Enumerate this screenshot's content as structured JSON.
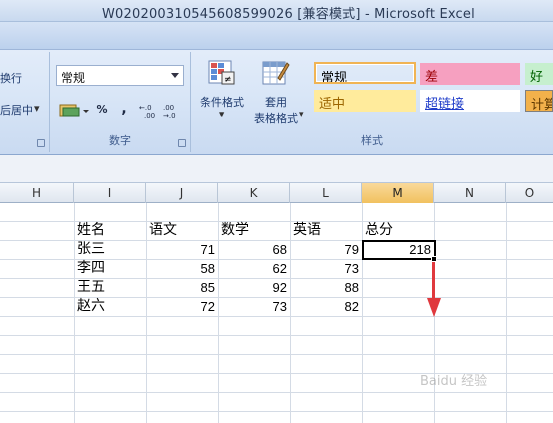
{
  "window": {
    "title": "W020200310545608599026  [兼容模式] - Microsoft Excel"
  },
  "ribbon": {
    "alignment": {
      "wrap_label": "换行",
      "merge_center_label": "后居中"
    },
    "number": {
      "format_value": "常规",
      "percent_label": "%",
      "comma_label": ",",
      "inc_decimal_label": "←.0 .00",
      "dec_decimal_label": ".00 →.0",
      "group_label": "数字"
    },
    "styles": {
      "conditional_format_label": "条件格式",
      "format_table_label_1": "套用",
      "format_table_label_2": "表格格式",
      "cells": [
        {
          "label": "常规",
          "bg": "#ffffff",
          "color": "#000000"
        },
        {
          "label": "差",
          "bg": "#f6a0c0",
          "color": "#9c0006"
        },
        {
          "label": "好",
          "bg": "#c6efce",
          "color": "#006100"
        },
        {
          "label": "适中",
          "bg": "#ffeb9c",
          "color": "#9c6500"
        },
        {
          "label": "超链接",
          "bg": "#ffffff",
          "color": "#1f3cc9"
        },
        {
          "label": "计算",
          "bg": "#f2b14b",
          "color": "#5e3800"
        }
      ],
      "group_label": "样式"
    }
  },
  "sheet": {
    "columns": [
      "H",
      "I",
      "J",
      "K",
      "L",
      "M",
      "N",
      "O"
    ],
    "active_column": "M",
    "headers": [
      "姓名",
      "语文",
      "数学",
      "英语",
      "总分"
    ],
    "rows": [
      {
        "name": "张三",
        "chinese": "71",
        "math": "68",
        "english": "79",
        "total": "218"
      },
      {
        "name": "李四",
        "chinese": "58",
        "math": "62",
        "english": "73",
        "total": ""
      },
      {
        "name": "王五",
        "chinese": "85",
        "math": "92",
        "english": "88",
        "total": ""
      },
      {
        "name": "赵六",
        "chinese": "72",
        "math": "73",
        "english": "82",
        "total": ""
      }
    ]
  },
  "colors": {
    "accent_arrow": "#e0393e",
    "selection": "#000000"
  },
  "watermark": {
    "text": "Baidu 经验"
  }
}
